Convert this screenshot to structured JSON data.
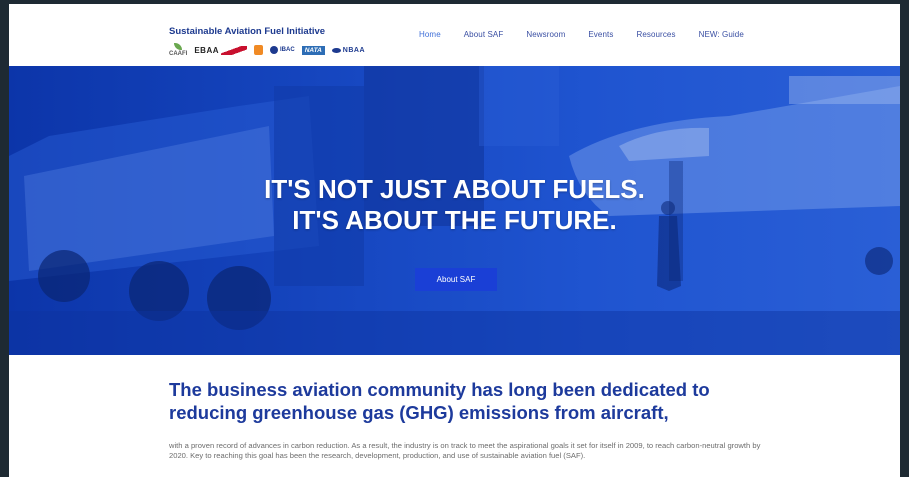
{
  "site": {
    "title": "Sustainable Aviation Fuel Initiative"
  },
  "logos": {
    "caafi": "CAAFI",
    "ebaa": "EBAA",
    "ibac": "IBAC",
    "nata": "NATA",
    "nbaa": "NBAA"
  },
  "nav": [
    {
      "label": "Home"
    },
    {
      "label": "About SAF"
    },
    {
      "label": "Newsroom"
    },
    {
      "label": "Events"
    },
    {
      "label": "Resources"
    },
    {
      "label": "NEW: Guide"
    }
  ],
  "hero": {
    "line1": "IT'S NOT JUST ABOUT FUELS.",
    "line2": "IT'S ABOUT THE FUTURE.",
    "button": "About SAF"
  },
  "content": {
    "heading": "The business aviation community has long been dedicated to reducing greenhouse gas (GHG) emissions from aircraft,",
    "body": "with a proven record of advances in carbon reduction. As a result, the industry is on track to meet the aspirational goals it set for itself in 2009, to reach carbon-neutral growth by 2020. Key to reaching this goal has been the research, development, production, and use of sustainable aviation fuel (SAF)."
  },
  "colors": {
    "brand": "#1d3a8f",
    "hero_blue": "#1748c2",
    "button": "#1a3fd6"
  }
}
